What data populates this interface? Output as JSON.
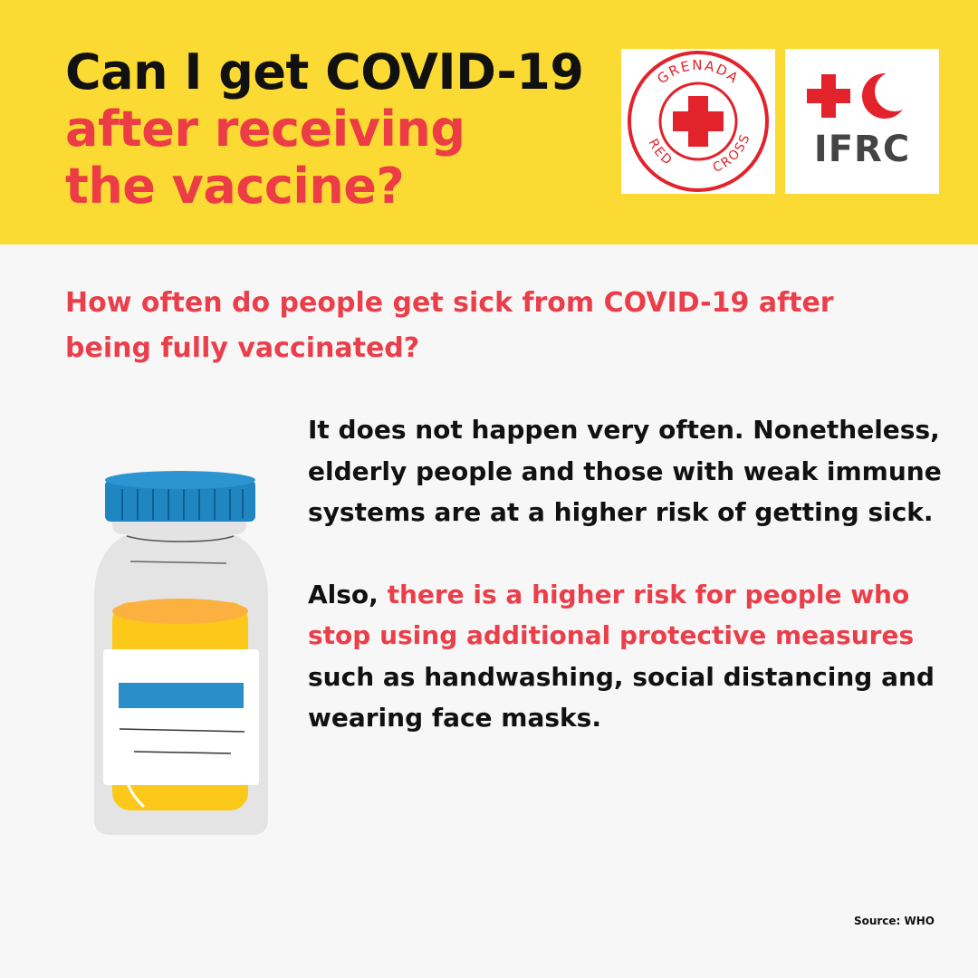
{
  "header": {
    "title_line1": "Can I get COVID-19",
    "title_line2": "after receiving",
    "title_line3": "the vaccine?",
    "logos": {
      "grenada_top": "GRENADA",
      "grenada_bottom_left": "RED",
      "grenada_bottom_right": "CROSS",
      "ifrc": "IFRC"
    }
  },
  "content": {
    "question": "How often do people get sick from COVID-19 after being fully vaccinated?",
    "paragraph1": "It does not happen very often. Nonetheless, elderly people and those with weak immune systems are at a higher risk of getting sick.",
    "paragraph2_lead": "Also, ",
    "paragraph2_highlight": "there is a higher risk for people who stop using additional protective measures",
    "paragraph2_tail": " such as handwashing, social distancing and wearing face masks."
  },
  "footer": {
    "source": "Source: WHO"
  },
  "colors": {
    "header_bg": "#fbdb33",
    "accent_red": "#ea3f4a",
    "text_dark": "#111111",
    "page_bg": "#f7f7f7",
    "cap_blue": "#1f86c2",
    "liquid_yellow": "#fcc81a"
  },
  "icons": [
    "vaccine-bottle-icon",
    "red-cross-icon",
    "red-crescent-icon"
  ]
}
